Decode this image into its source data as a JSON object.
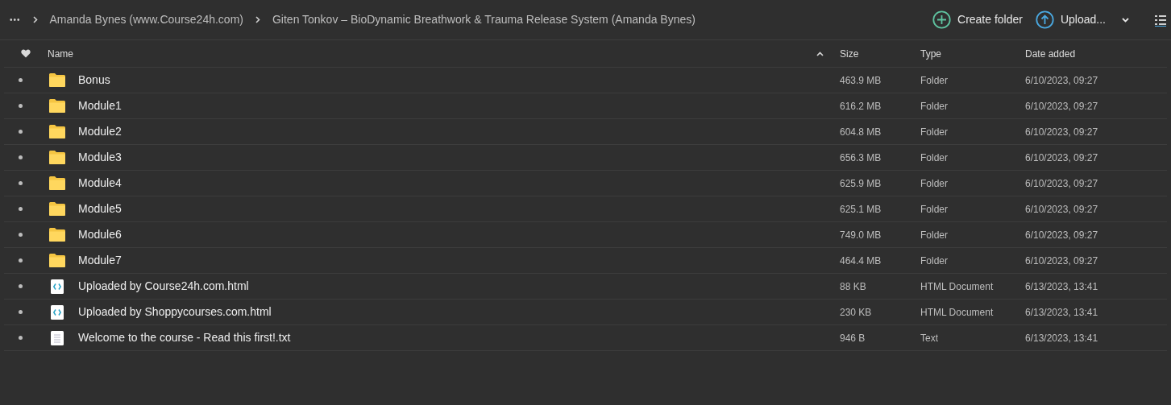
{
  "breadcrumb": {
    "more": "•••",
    "items": [
      "Amanda Bynes (www.Course24h.com)",
      "Giten Tonkov – BioDynamic Breathwork & Trauma Release System (Amanda Bynes)"
    ]
  },
  "toolbar": {
    "create_folder": "Create folder",
    "upload": "Upload..."
  },
  "table": {
    "columns": [
      "Name",
      "Size",
      "Type",
      "Date added"
    ],
    "rows": [
      {
        "kind": "folder",
        "name": "Bonus",
        "size": "463.9 MB",
        "type": "Folder",
        "date": "6/10/2023, 09:27"
      },
      {
        "kind": "folder",
        "name": "Module1",
        "size": "616.2 MB",
        "type": "Folder",
        "date": "6/10/2023, 09:27"
      },
      {
        "kind": "folder",
        "name": "Module2",
        "size": "604.8 MB",
        "type": "Folder",
        "date": "6/10/2023, 09:27"
      },
      {
        "kind": "folder",
        "name": "Module3",
        "size": "656.3 MB",
        "type": "Folder",
        "date": "6/10/2023, 09:27"
      },
      {
        "kind": "folder",
        "name": "Module4",
        "size": "625.9 MB",
        "type": "Folder",
        "date": "6/10/2023, 09:27"
      },
      {
        "kind": "folder",
        "name": "Module5",
        "size": "625.1 MB",
        "type": "Folder",
        "date": "6/10/2023, 09:27"
      },
      {
        "kind": "folder",
        "name": "Module6",
        "size": "749.0 MB",
        "type": "Folder",
        "date": "6/10/2023, 09:27"
      },
      {
        "kind": "folder",
        "name": "Module7",
        "size": "464.4 MB",
        "type": "Folder",
        "date": "6/10/2023, 09:27"
      },
      {
        "kind": "html",
        "name": "Uploaded by Course24h.com.html",
        "size": "88 KB",
        "type": "HTML Document",
        "date": "6/13/2023, 13:41"
      },
      {
        "kind": "html",
        "name": "Uploaded by Shoppycourses.com.html",
        "size": "230 KB",
        "type": "HTML Document",
        "date": "6/13/2023, 13:41"
      },
      {
        "kind": "text",
        "name": "Welcome to the course - Read this first!.txt",
        "size": "946 B",
        "type": "Text",
        "date": "6/13/2023, 13:41"
      }
    ]
  }
}
